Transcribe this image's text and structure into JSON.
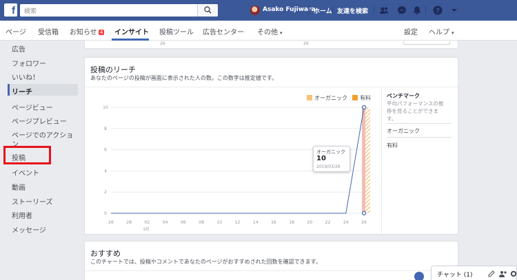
{
  "topbar": {
    "search_placeholder": "検索",
    "user_name": "Asako Fujiwara",
    "home": "ホーム",
    "find_friends": "友達を検索",
    "icons": [
      "friend-requests-icon",
      "messenger-icon",
      "notifications-icon",
      "help-icon",
      "account-menu-icon"
    ]
  },
  "nav": {
    "items": [
      "ページ",
      "受信箱",
      "お知らせ",
      "インサイト",
      "投稿ツール",
      "広告センター",
      "その他"
    ],
    "notification_badge": "4",
    "settings": "設定",
    "help": "ヘルプ",
    "caret": "▾"
  },
  "sidebar": {
    "items": [
      "広告",
      "フォロワー",
      "いいね！",
      "リーチ",
      "ページビュー",
      "ページプレビュー",
      "ページでのアクショ",
      "ン",
      "投稿",
      "イベント",
      "動画",
      "ストーリーズ",
      "利用者",
      "メッセージ"
    ],
    "selected": "リーチ",
    "highlighted": "投稿"
  },
  "top_panel": {
    "ticks": [
      "26",
      "26"
    ]
  },
  "reach_panel": {
    "title": "投稿のリーチ",
    "subtitle": "あなたのページの投稿が画面に表示された人の数。この数字は推定値です。",
    "legend": [
      {
        "label": "オーガニック",
        "color": "#f7c37a"
      },
      {
        "label": "有料",
        "color": "#f0a030"
      }
    ],
    "benchmark_title": "ベンチマーク",
    "benchmark_desc_1": "平均パフォーマンスの推",
    "benchmark_desc_2": "移を見ることができま",
    "benchmark_desc_3": "す。",
    "benchmark_organic": "オーガニック",
    "benchmark_paid": "有料",
    "tooltip": {
      "label": "オーガニック",
      "value": "10",
      "date": "2019/03/26"
    }
  },
  "chart_data": {
    "type": "line",
    "y_ticks": [
      "10",
      "8",
      "6",
      "4",
      "2",
      "0"
    ],
    "ylim": [
      0,
      10
    ],
    "x_ticks": [
      "26",
      "28",
      "02",
      "04",
      "06",
      "08",
      "10",
      "12",
      "14",
      "16",
      "18",
      "20",
      "22",
      "24",
      "26"
    ],
    "x_sublabel": "3月",
    "series": [
      {
        "name": "オーガニック",
        "values": [
          0,
          0,
          0,
          0,
          0,
          0,
          0,
          0,
          0,
          0,
          0,
          0,
          0,
          0,
          10
        ]
      }
    ],
    "grid": true,
    "highlight_index": 14
  },
  "recommend_panel": {
    "title": "おすすめ",
    "subtitle": "このチャートでは、投稿やコメントであなたのページがおすすめされた回数を確認できます。"
  },
  "chat": {
    "label": "チャット (1)"
  }
}
